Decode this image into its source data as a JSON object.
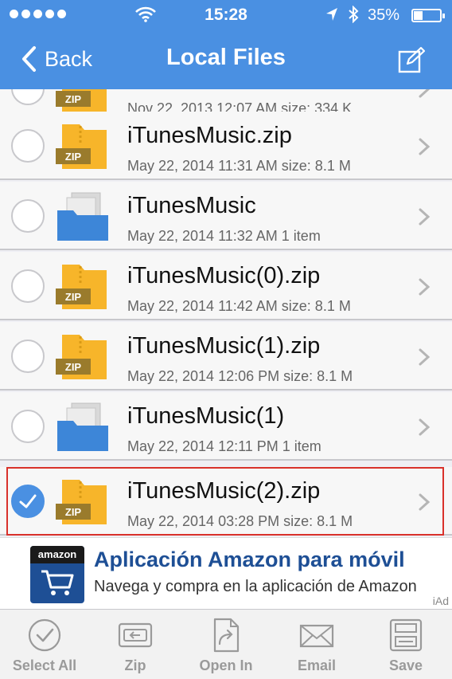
{
  "status_bar": {
    "time": "15:28",
    "battery": "35%",
    "icons": [
      "signal-dots-icon",
      "wifi-icon",
      "location-arrow-icon",
      "bluetooth-icon",
      "battery-icon"
    ]
  },
  "nav": {
    "back_label": "Back",
    "title": "Local Files",
    "edit_icon": "edit-icon"
  },
  "files": [
    {
      "name": "",
      "meta": "Nov 22, 2013 12:07 AM  size: 334 K",
      "type": "zip",
      "selected": false
    },
    {
      "name": "iTunesMusic.zip",
      "meta": "May 22, 2014 11:31 AM  size: 8.1 M",
      "type": "zip",
      "selected": false
    },
    {
      "name": "iTunesMusic",
      "meta": "May 22, 2014 11:32 AM  1 item",
      "type": "folder",
      "selected": false
    },
    {
      "name": "iTunesMusic(0).zip",
      "meta": "May 22, 2014 11:42 AM  size: 8.1 M",
      "type": "zip",
      "selected": false
    },
    {
      "name": "iTunesMusic(1).zip",
      "meta": "May 22, 2014 12:06 PM  size: 8.1 M",
      "type": "zip",
      "selected": false
    },
    {
      "name": "iTunesMusic(1)",
      "meta": "May 22, 2014 12:11 PM  1 item",
      "type": "folder",
      "selected": false
    },
    {
      "name": "iTunesMusic(2).zip",
      "meta": "May 22, 2014 03:28 PM  size: 8.1 M",
      "type": "zip",
      "selected": true
    }
  ],
  "zip_badge": "ZIP",
  "ad": {
    "brand": "amazon",
    "title": "Aplicación Amazon para móvil",
    "subtitle": "Navega y compra en la aplicación de Amazon",
    "network": "iAd"
  },
  "toolbar": {
    "select_all": "Select All",
    "zip": "Zip",
    "open_in": "Open In",
    "email": "Email",
    "save": "Save"
  },
  "colors": {
    "accent": "#4a90e2",
    "folder_yellow": "#f7b52a",
    "folder_blue": "#3d86d8",
    "zip_badge": "#9a7b2c",
    "selection_outline": "#d9312b"
  }
}
